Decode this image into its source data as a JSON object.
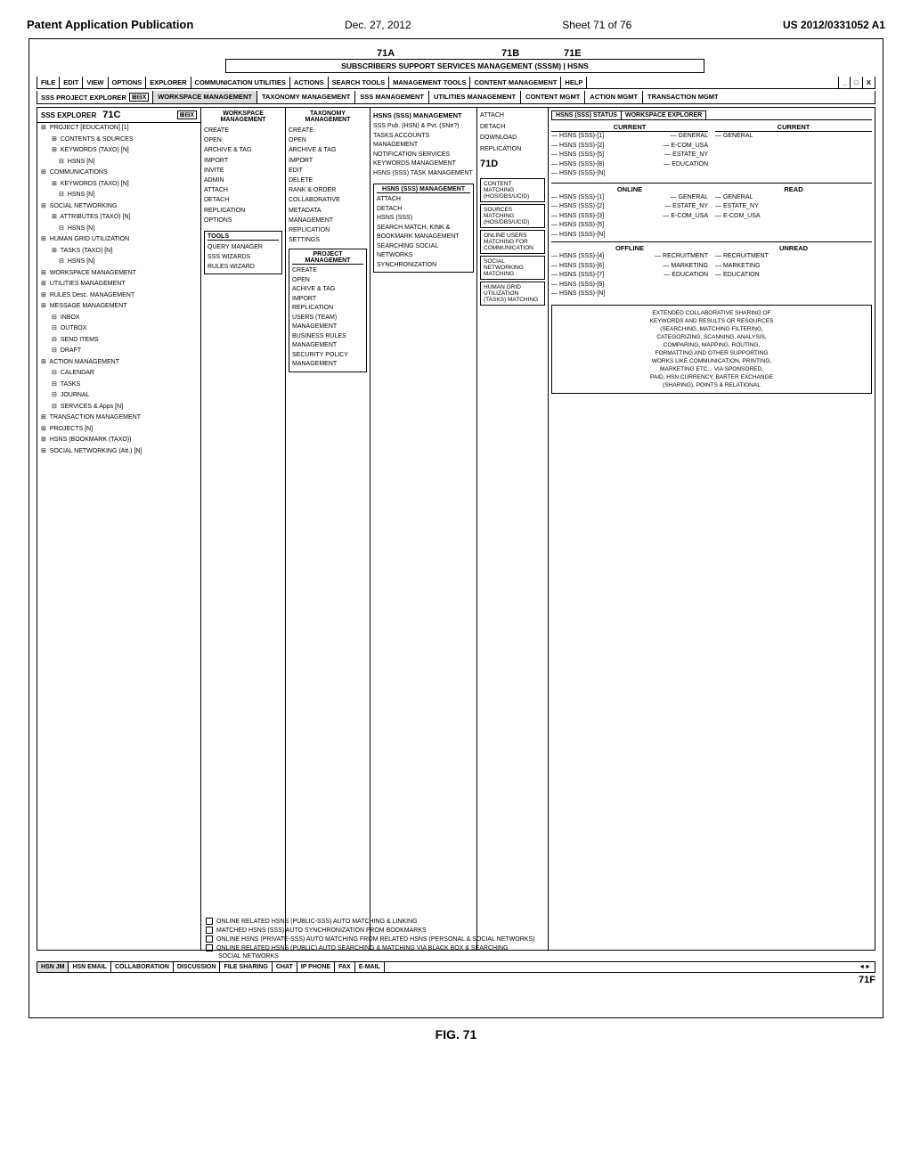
{
  "header": {
    "pub_title": "Patent Application Publication",
    "pub_date": "Dec. 27, 2012",
    "pub_sheet": "Sheet 71 of 76",
    "pub_number": "US 2012/0331052 A1"
  },
  "diagram": {
    "labels": {
      "a71A": "71A",
      "a71B": "71B",
      "a71C": "71C",
      "a71D": "71D",
      "a71E": "71E",
      "a71F": "71F"
    },
    "top_title": "SUBSCRIBERS SUPPORT SERVICES MANAGEMENT (SSSM) | HSNS",
    "menu_items": [
      "FILE",
      "EDIT",
      "VIEW",
      "OPTIONS",
      "EXPLORER",
      "COMMUNICATION UTILITIES",
      "ACTIONS",
      "SEARCH TOOLS",
      "MANAGEMENT TOOLS",
      "CONTENT MANAGEMENT",
      "HELP"
    ],
    "window_controls": [
      "_",
      "□",
      "X"
    ],
    "tabs": [
      "SSS PROJECT EXPLORER",
      "WORKSPACE MANAGEMENT",
      "TAXONOMY MANAGEMENT",
      "SSS MANAGEMENT",
      "UTILITIES MANAGEMENT",
      "CONTENT MGMT",
      "ACTION MGMT",
      "TRANSACTION MGMT"
    ],
    "explorer_header": "SSS EXPLORER",
    "tree_items": [
      {
        "level": 1,
        "icon": "⊞",
        "label": "PROJECT [EDUCATION] [1]"
      },
      {
        "level": 2,
        "icon": "⊞",
        "label": "CONTENTS & SOURCES"
      },
      {
        "level": 2,
        "icon": "⊞",
        "label": "KEYWORDS (TAXO) [N]"
      },
      {
        "level": 3,
        "icon": "⊟",
        "label": "HSNS [N]"
      },
      {
        "level": 1,
        "icon": "⊞",
        "label": "COMMUNICATIONS"
      },
      {
        "level": 2,
        "icon": "⊞",
        "label": "KEYWORDS (TAXO) [N]"
      },
      {
        "level": 3,
        "icon": "⊟",
        "label": "HSNS [N]"
      },
      {
        "level": 1,
        "icon": "⊞",
        "label": "SOCIAL NETWORKING"
      },
      {
        "level": 2,
        "icon": "⊞",
        "label": "ATTRIBUTES (TAXO) [N]"
      },
      {
        "level": 3,
        "icon": "⊟",
        "label": "HSNS [N]"
      },
      {
        "level": 1,
        "icon": "⊞",
        "label": "HUMAN GRID UTILIZATION"
      },
      {
        "level": 2,
        "icon": "⊞",
        "label": "TASKS (TAXO) [N]"
      },
      {
        "level": 3,
        "icon": "⊟",
        "label": "HSNS [N]"
      },
      {
        "level": 1,
        "icon": "⊞",
        "label": "WORKSPACE MANAGEMENT"
      },
      {
        "level": 1,
        "icon": "⊞",
        "label": "UTILITIES MANAGEMENT"
      },
      {
        "level": 1,
        "icon": "⊞",
        "label": "RULES Desc. MANAGEMENT"
      },
      {
        "level": 1,
        "icon": "⊞",
        "label": "MESSAGE MANAGEMENT"
      },
      {
        "level": 2,
        "icon": "⊟",
        "label": "INBOX"
      },
      {
        "level": 2,
        "icon": "⊟",
        "label": "OUTBOX"
      },
      {
        "level": 2,
        "icon": "⊟",
        "label": "SEND ITEMS"
      },
      {
        "level": 2,
        "icon": "⊟",
        "label": "DRAFT"
      },
      {
        "level": 1,
        "icon": "⊞",
        "label": "ACTION MANAGEMENT"
      },
      {
        "level": 2,
        "icon": "⊟",
        "label": "CALENDAR"
      },
      {
        "level": 2,
        "icon": "⊟",
        "label": "TASKS"
      },
      {
        "level": 2,
        "icon": "⊟",
        "label": "JOURNAL"
      },
      {
        "level": 2,
        "icon": "⊟",
        "label": "SERVICES & Apps [N]"
      },
      {
        "level": 1,
        "icon": "⊞",
        "label": "TRANSACTION MANAGEMENT"
      },
      {
        "level": 1,
        "icon": "⊞",
        "label": "PROJECTS [N]"
      },
      {
        "level": 1,
        "icon": "⊞",
        "label": "HSNS (BOOKMARK (TAXO))"
      },
      {
        "level": 1,
        "icon": "⊞",
        "label": "SOCIAL NETWORKING (Att.) [N]"
      }
    ],
    "workspace_menu": {
      "title": "WORKSPACE MANAGEMENT",
      "items": [
        "CREATE",
        "OPEN",
        "ARCHIVE & TAG",
        "IMPORT",
        "INVITE",
        "ADMIN",
        "ATTACH",
        "DETACH",
        "REPLICATION",
        "OPTIONS"
      ]
    },
    "taxonomy_menu": {
      "title": "TAXONOMY MANAGEMENT",
      "items": [
        "CREATE",
        "OPEN",
        "ARCHIVE & TAG",
        "IMPORT",
        "EDIT",
        "DELETE",
        "RANK & ORDER",
        "COLLABORATIVE",
        "METADATA MANAGEMENT",
        "REPLICATION",
        "SETTINGS"
      ]
    },
    "sss_menu": {
      "title": "SSS MANAGEMENT",
      "items_top": [
        "HSNS (SSS) MANAGEMENT",
        "SSS Pub. (HSN) & Pvt. (SNe?)",
        "TASKS ACCOUNTS MANAGEMENT",
        "NOTIFICATION SERVICES",
        "KEYWORDS MANAGEMENT",
        "HSNS (SSS) TASK MANAGEMENT"
      ]
    },
    "attach_menu": {
      "title": "",
      "items": [
        "ATTACH",
        "DETACH",
        "DOWNLOAD",
        "REPLICATION"
      ]
    },
    "tools_section": {
      "title": "TOOLS",
      "items": [
        "QUERY MANAGER",
        "SSS WIZARDS",
        "RULES WIZARD"
      ]
    },
    "project_mgmt": {
      "title": "PROJECT MANAGEMENT",
      "items": [
        "CREATE",
        "OPEN",
        "ACHIVE & TAG",
        "IMPORT",
        "REPLICATION",
        "USERS (TEAM) MANAGEMENT",
        "BUSINESS RULES MANAGEMENT",
        "SECURITY POLICY MANAGEMENT"
      ]
    },
    "hsns_sss_mgmt": {
      "title": "HSNS (SSS) MANAGEMENT",
      "items": [
        "ATTACH",
        "DETACH",
        "HSNS (SSS)",
        "SEARCH MATCH, KINK & BOOKMARK MANAGEMENT",
        "SEARCHING SOCIAL NETWORKS",
        "SYNCHRONIZATION"
      ]
    },
    "content_matching": {
      "label1": "CONTENT MATCHING (HOS/DBS/UCID)",
      "label2": "SOURCES MATCHING (HOS/DBS/UCID)",
      "label3": "ONLINE USERS MATCHING FOR COMMUNICATION",
      "label4": "SOCIAL NETWORKING MATCHING",
      "label5": "HUMAN GRID UTILIZATION (TASKS) MATCHING"
    },
    "right_panel": {
      "tabs": [
        "HSNS (SSS) STATUS",
        "WORKSPACE EXPLORER"
      ],
      "current_header": "CURRENT",
      "read_header": "READ",
      "online_header": "ONLINE",
      "offline_header": "OFFLINE",
      "unread_header": "UNREAD",
      "current_items": [
        {
          "left": "HSNS (SSS)-[1]",
          "right": "GENERAL"
        },
        {
          "left": "HSNS (SSS)-[2]",
          "right": "E-COM_USA"
        },
        {
          "left": "HSNS (SSS)-[5]",
          "right": "ESTATE_NY"
        },
        {
          "left": "HSNS (SSS)-[8]",
          "right": "EDUCATION"
        },
        {
          "left": "HSNS (SSS)-[N]",
          "right": ""
        }
      ],
      "online_read_items": [
        {
          "left": "HSNS (SSS)-[1]",
          "right": "GENERAL"
        },
        {
          "left": "HSNS (SSS)-[2]",
          "right": "ESTATE_NY"
        },
        {
          "left": "HSNS (SSS)-[3]",
          "right": "E-COM_USA"
        },
        {
          "left": "HSNS (SSS)-[5]",
          "right": ""
        },
        {
          "left": "HSNS (SSS)-[N]",
          "right": ""
        }
      ],
      "offline_unread_items": [
        {
          "left": "HSNS (SSS)-[4]",
          "right": "RECRUITMENT"
        },
        {
          "left": "HSNS (SSS)-[6]",
          "right": "MARKETING"
        },
        {
          "left": "HSNS (SSS)-[7]",
          "right": "EDUCATION"
        },
        {
          "left": "HSNS (SSS)-[9]",
          "right": ""
        },
        {
          "left": "HSNS (SSS)-[N]",
          "right": ""
        }
      ],
      "desc_box": "EXTENDED COLLABORATIVE SHARING OF KEYWORDS AND RESULTS OR RESOURCES (SEARCHING, MATCHING FILTERING, CATEGORIZING, SCANNING, ANALYSIS, COMPARING, MAPPING, ROUTING, FORMATTING AND OTHER SUPPORTING WORKS LIKE COMMUNICATION, PRINTING, MARKETING ETC... VIA SPONSORED, PAID, HSN CURRENCY, BARTER EXCHANGE (SHARING), POINTS & RELATIONAL"
    },
    "footer_checkboxes": [
      "ONLINE RELATED HSNS (PUBLIC-SSS) AUTO MATCHING & LINKING",
      "MATCHED HSNS (SSS) AUTO SYNCHRONIZATION FROM BOOKMARKS",
      "ONLINE HSNS (PRIVATE-SSS) AUTO MATCHING FROM RELATED HSNS (PERSONAL & SOCIAL NETWORKS)",
      "ONLINE RELATED HSNS (PUBLIC) AUTO SEARCHING & MATCHING VIA BLACK BOX & SEARCHING SOCIAL NETWORKS"
    ],
    "bottom_tabs": [
      "HSN JM",
      "HSN EMAIL",
      "COLLABORATION",
      "DISCUSSION",
      "FILE SHARING",
      "CHAT",
      "IP PHONE",
      "FAX",
      "E-MAIL"
    ],
    "fig_label": "FIG. 71"
  }
}
